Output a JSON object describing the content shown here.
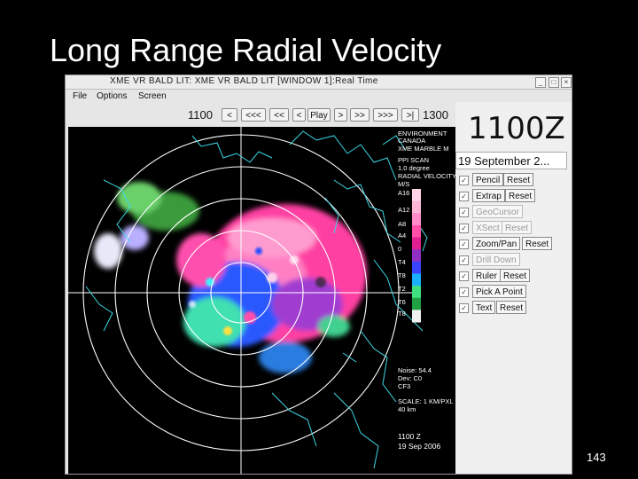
{
  "slide": {
    "title": "Long Range Radial Velocity",
    "number": "143"
  },
  "window": {
    "title": "XME VR BALD LIT: XME VR BALD LIT [WINDOW 1]:Real Time",
    "menu": [
      "File",
      "Options",
      "Screen"
    ]
  },
  "timeline": {
    "start_label": "1100",
    "end_label": "1300",
    "buttons": [
      "<",
      "<<<",
      "<<",
      "<",
      "Play",
      ">",
      ">>",
      ">>>",
      ">|"
    ]
  },
  "panel": {
    "big_time": "1100Z",
    "date": "19 September 2...",
    "tools": [
      {
        "label": "Pencil",
        "reset": "Reset",
        "checked": true,
        "enabled": true
      },
      {
        "label": "Extrap",
        "reset": "Reset",
        "checked": true,
        "enabled": true
      },
      {
        "label": "GeoCursor",
        "reset": "",
        "checked": true,
        "enabled": false
      },
      {
        "label": "XSect",
        "reset": "Reset",
        "checked": true,
        "enabled": false
      },
      {
        "label": "Zoom/Pan",
        "reset": "Reset",
        "checked": true,
        "enabled": true
      },
      {
        "label": "Drill Down",
        "reset": "",
        "checked": true,
        "enabled": false
      },
      {
        "label": "Ruler",
        "reset": "Reset",
        "checked": true,
        "enabled": true
      },
      {
        "label": "Pick A Point",
        "reset": "",
        "checked": true,
        "enabled": true
      },
      {
        "label": "Text",
        "reset": "Reset",
        "checked": true,
        "enabled": true
      }
    ]
  },
  "radar_info": {
    "header_lines": [
      "ENVIRONMENT",
      "CANADA",
      "XME MARBLE M",
      "PPI SCAN",
      "1.0 degree",
      "RADIAL VELOCITY",
      "M/S"
    ],
    "scale_labels": [
      "A16",
      "A12",
      "A8",
      "A4",
      "0",
      "T4",
      "T8",
      "T2",
      "T6",
      "T8"
    ],
    "scale_colors": [
      "#ffd2e8",
      "#ffb6d6",
      "#ff8cc8",
      "#ff4fa8",
      "#e02090",
      "#9030c0",
      "#3a44ff",
      "#18b0ff",
      "#40e080",
      "#20a040",
      "#f0f0f0"
    ],
    "footer_lines": [
      "Noise: 54.4",
      "Dev: C0",
      "CF3",
      "SCALE: 1 KM/PXL",
      "40 km"
    ],
    "time_lines": [
      "1100 Z",
      "19 Sep 2006"
    ]
  }
}
